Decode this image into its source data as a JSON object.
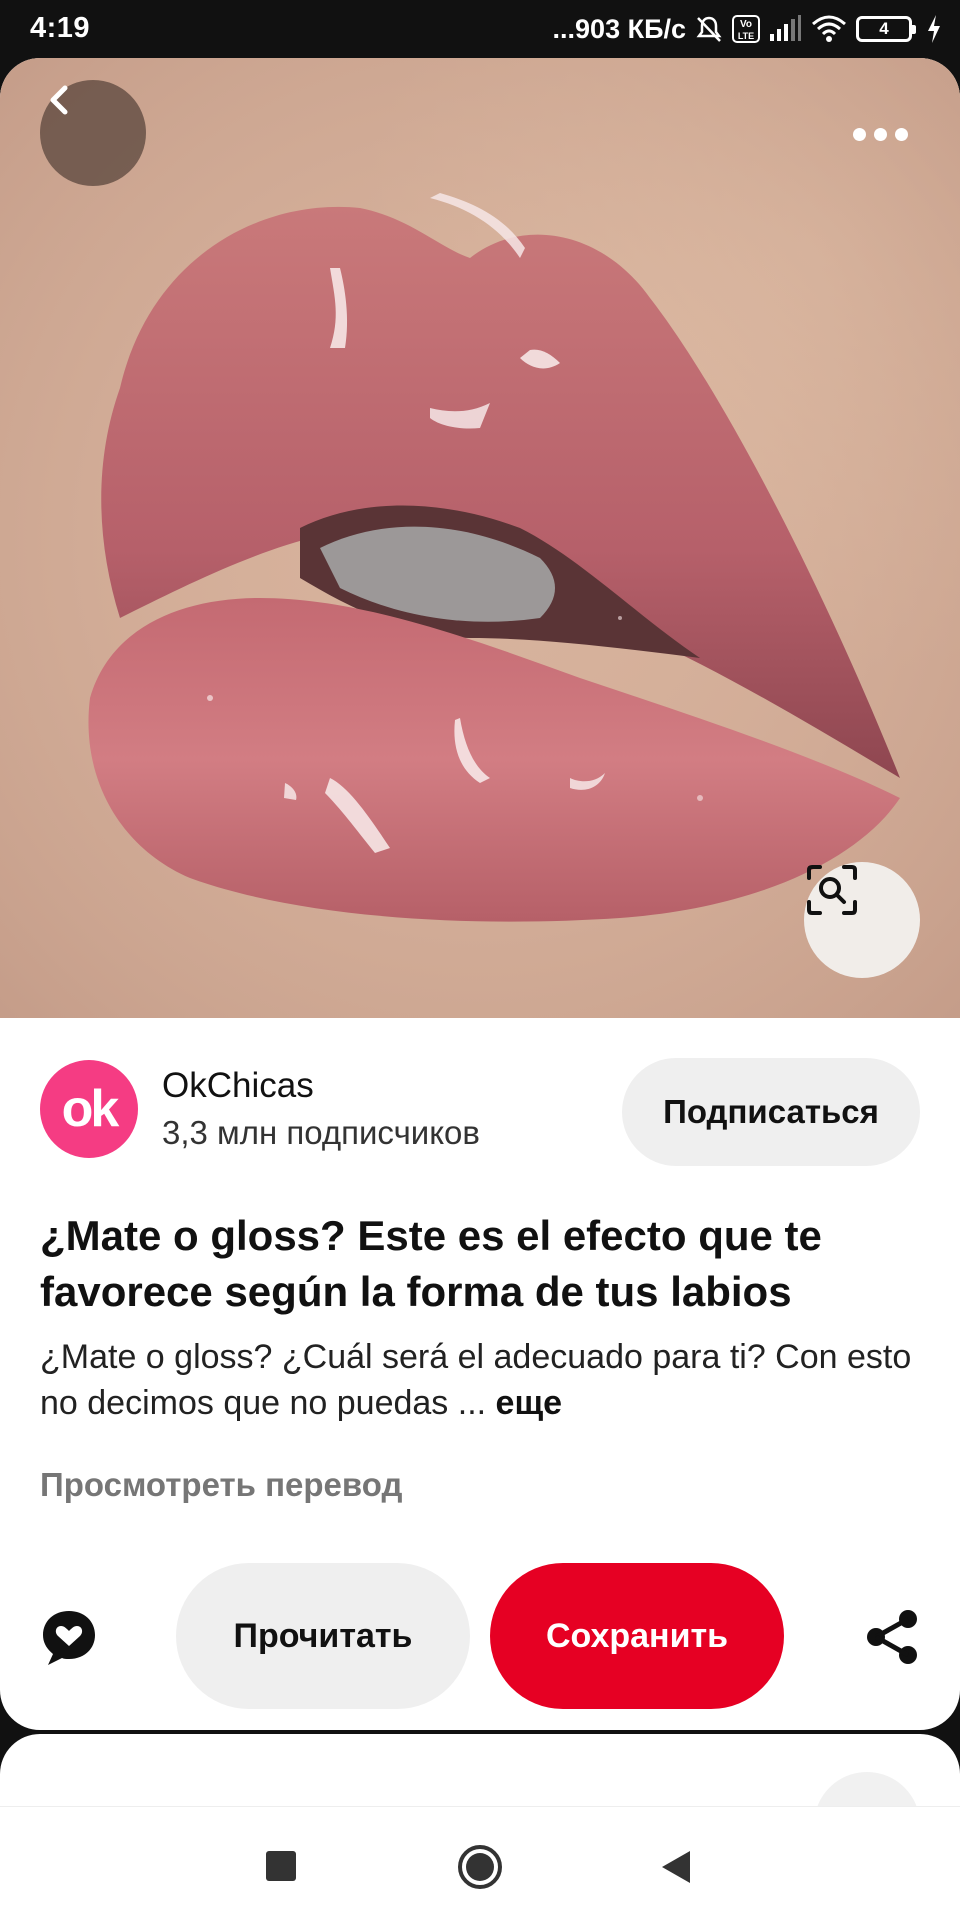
{
  "status_bar": {
    "time": "4:19",
    "network_speed": "...903 КБ/с",
    "volte_label": "Vo LTE",
    "battery_level": "4",
    "icons": [
      "mute-icon",
      "volte-icon",
      "signal-icon",
      "wifi-icon",
      "battery-icon",
      "charging-icon"
    ]
  },
  "pin": {
    "image_description_icons": [
      "back-arrow-icon",
      "more-dots-icon",
      "visual-search-icon"
    ],
    "creator": {
      "avatar_text": "ok",
      "name": "OkChicas",
      "followers": "3,3 млн подписчиков",
      "subscribe_label": "Подписаться"
    },
    "title": "¿Mate o gloss? Este es el efecto que te favorece según la forma de tus labios",
    "description": "¿Mate o gloss? ¿Cuál será el adecuado para ti? Con esto no decimos que no puedas ...",
    "description_more": "еще",
    "translate_label": "Просмотреть перевод",
    "actions": {
      "read_label": "Прочитать",
      "save_label": "Сохранить"
    }
  },
  "colors": {
    "save_red": "#e60023",
    "avatar_pink": "#f53c83",
    "button_grey": "#efefef"
  }
}
